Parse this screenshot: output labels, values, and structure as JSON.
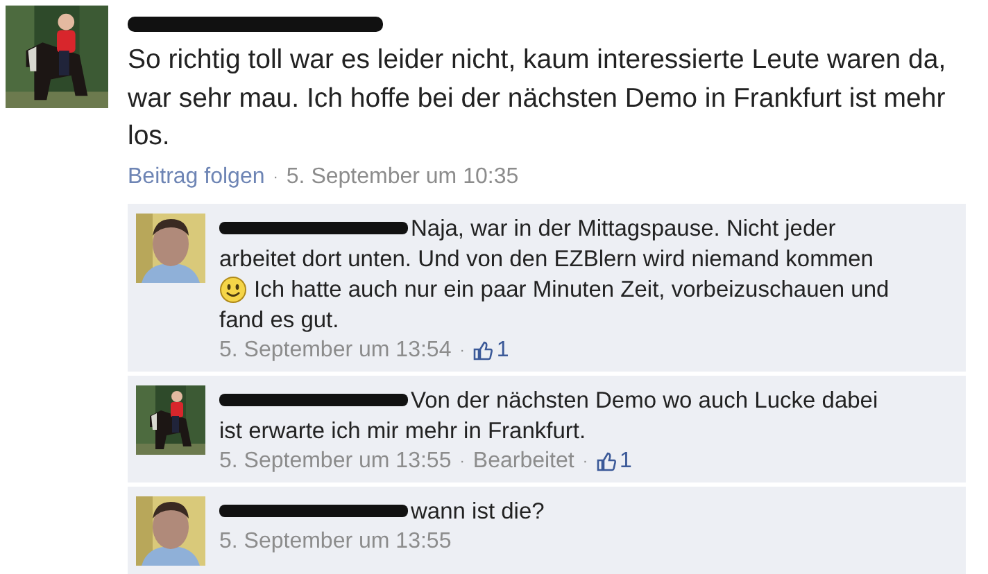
{
  "post": {
    "author_redacted": true,
    "text": "So richtig toll war es leider nicht, kaum interessierte Leute waren da, war sehr mau. Ich hoffe bei der nächsten Demo in Frankfurt ist mehr los.",
    "meta": [
      {
        "kind": "link",
        "text": "Beitrag folgen"
      },
      {
        "kind": "sep",
        "text": "·"
      },
      {
        "kind": "time",
        "text": "5. September um 10:35"
      }
    ]
  },
  "comments": [
    {
      "author_redacted": true,
      "lines": [
        [
          {
            "kind": "text",
            "text": "Naja, war in der Mittagspause. Nicht jeder"
          }
        ],
        [
          {
            "kind": "text",
            "text": "arbeitet dort unten. Und von den EZBlern wird niemand kommen"
          }
        ],
        [
          {
            "kind": "smiley"
          },
          {
            "kind": "text",
            "text": "Ich hatte auch nur ein paar Minuten Zeit, vorbeizuschauen und"
          }
        ],
        [
          {
            "kind": "text",
            "text": "fand es gut."
          }
        ]
      ],
      "meta": [
        {
          "kind": "time",
          "text": "5. September um 13:54"
        },
        {
          "kind": "sep",
          "text": "·"
        },
        {
          "kind": "likes",
          "text": "1"
        }
      ]
    },
    {
      "author_redacted": true,
      "lines": [
        [
          {
            "kind": "text",
            "text": "Von der nächsten Demo wo auch Lucke dabei"
          }
        ],
        [
          {
            "kind": "text",
            "text": "ist erwarte ich mir mehr in Frankfurt."
          }
        ]
      ],
      "meta": [
        {
          "kind": "time",
          "text": "5. September um 13:55"
        },
        {
          "kind": "sep",
          "text": "·"
        },
        {
          "kind": "time",
          "text": "Bearbeitet"
        },
        {
          "kind": "sep",
          "text": "·"
        },
        {
          "kind": "likes",
          "text": "1"
        }
      ]
    },
    {
      "author_redacted": true,
      "lines": [
        [
          {
            "kind": "text",
            "text": "wann ist die?"
          }
        ]
      ],
      "meta": [
        {
          "kind": "time",
          "text": "5. September um 13:55"
        }
      ]
    }
  ]
}
